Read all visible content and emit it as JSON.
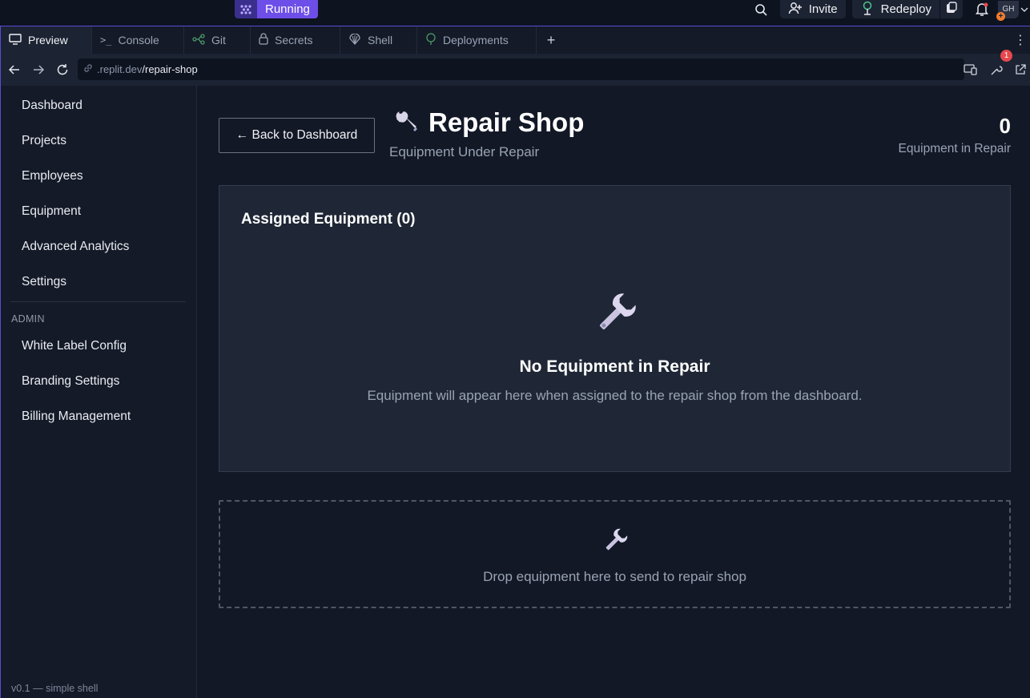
{
  "topbar": {
    "run_label": "Running",
    "invite_label": "Invite",
    "redeploy_label": "Redeploy",
    "avatar_initials": "GH"
  },
  "tabs": [
    {
      "label": "Preview",
      "icon": "monitor-icon",
      "active": true
    },
    {
      "label": "Console",
      "icon": "terminal-icon"
    },
    {
      "label": "Git",
      "icon": "git-branch-icon"
    },
    {
      "label": "Secrets",
      "icon": "lock-icon"
    },
    {
      "label": "Shell",
      "icon": "shell-icon"
    },
    {
      "label": "Deployments",
      "icon": "deploy-icon"
    }
  ],
  "address": {
    "host": ".replit.dev",
    "path": "/repair-shop",
    "notification_count": "1"
  },
  "sidebar": {
    "items": [
      "Dashboard",
      "Projects",
      "Employees",
      "Equipment",
      "Advanced Analytics",
      "Settings"
    ],
    "section_label": "ADMIN",
    "admin_items": [
      "White Label Config",
      "Branding Settings",
      "Billing Management"
    ],
    "footer": "v0.1 — simple shell"
  },
  "page": {
    "back_label": "← Back to Dashboard",
    "title": "Repair Shop",
    "subtitle": "Equipment Under Repair",
    "stat_value": "0",
    "stat_label": "Equipment in Repair"
  },
  "card": {
    "title": "Assigned Equipment (0)",
    "empty_title": "No Equipment in Repair",
    "empty_sub": "Equipment will appear here when assigned to the repair shop from the dashboard."
  },
  "dropzone": {
    "text": "Drop equipment here to send to repair shop"
  },
  "colors": {
    "accent": "#6d4ee8",
    "background": "#121826",
    "card": "#1f2736"
  }
}
